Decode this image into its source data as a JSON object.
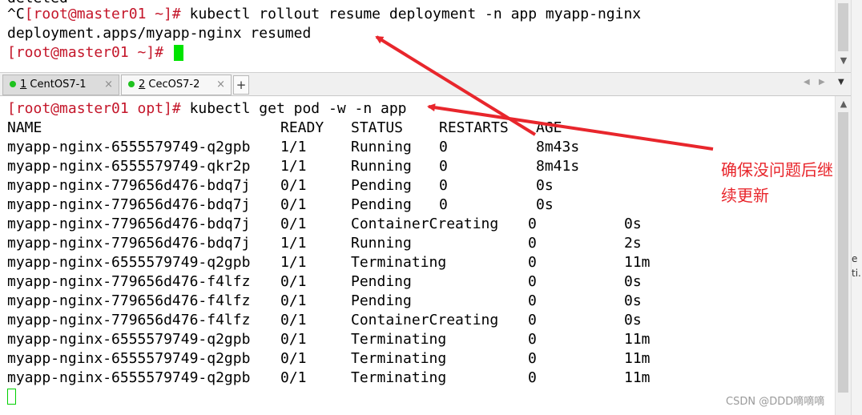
{
  "top_terminal": {
    "partial_prev": "deleted",
    "line1_ctrl": "^C",
    "line1_prompt": "[root@master01 ~]#",
    "line1_cmd": " kubectl rollout resume deployment -n app myapp-nginx",
    "line2": "deployment.apps/myapp-nginx resumed",
    "line3_prompt": "[root@master01 ~]#"
  },
  "tabs": [
    {
      "number": "1",
      "label": "CentOS7-1"
    },
    {
      "number": "2",
      "label": "CecOS7-2"
    }
  ],
  "tab_close": "×",
  "tab_add": "+",
  "tab_nav_prev": "◀",
  "tab_nav_next": "▶",
  "tab_menu": "▼",
  "bottom_terminal": {
    "prompt": "[root@master01 opt]#",
    "command": " kubectl get pod -w -n app",
    "headers": [
      "NAME",
      "READY",
      "STATUS",
      "RESTARTS",
      "AGE"
    ],
    "rows": [
      [
        "myapp-nginx-6555579749-q2gpb",
        "1/1",
        "Running",
        "0",
        "8m43s"
      ],
      [
        "myapp-nginx-6555579749-qkr2p",
        "1/1",
        "Running",
        "0",
        "8m41s"
      ],
      [
        "myapp-nginx-779656d476-bdq7j",
        "0/1",
        "Pending",
        "0",
        "0s"
      ],
      [
        "myapp-nginx-779656d476-bdq7j",
        "0/1",
        "Pending",
        "0",
        "0s"
      ],
      [
        "myapp-nginx-779656d476-bdq7j",
        "0/1",
        "ContainerCreating",
        "0",
        "0s"
      ],
      [
        "myapp-nginx-779656d476-bdq7j",
        "1/1",
        "Running",
        "0",
        "2s"
      ],
      [
        "myapp-nginx-6555579749-q2gpb",
        "1/1",
        "Terminating",
        "0",
        "11m"
      ],
      [
        "myapp-nginx-779656d476-f4lfz",
        "0/1",
        "Pending",
        "0",
        "0s"
      ],
      [
        "myapp-nginx-779656d476-f4lfz",
        "0/1",
        "Pending",
        "0",
        "0s"
      ],
      [
        "myapp-nginx-779656d476-f4lfz",
        "0/1",
        "ContainerCreating",
        "0",
        "0s"
      ],
      [
        "myapp-nginx-6555579749-q2gpb",
        "0/1",
        "Terminating",
        "0",
        "11m"
      ],
      [
        "myapp-nginx-6555579749-q2gpb",
        "0/1",
        "Terminating",
        "0",
        "11m"
      ],
      [
        "myapp-nginx-6555579749-q2gpb",
        "0/1",
        "Terminating",
        "0",
        "11m"
      ]
    ]
  },
  "annotation": "确保没问题后继\n续更新",
  "watermark": "CSDN @DDD嘀嘀嘀",
  "side_text": [
    "e",
    "ti.."
  ],
  "colors": {
    "prompt": "#c4162a",
    "cursor": "#00e400",
    "annotation": "#e8262c",
    "tab_dot": "#1ec21e"
  }
}
